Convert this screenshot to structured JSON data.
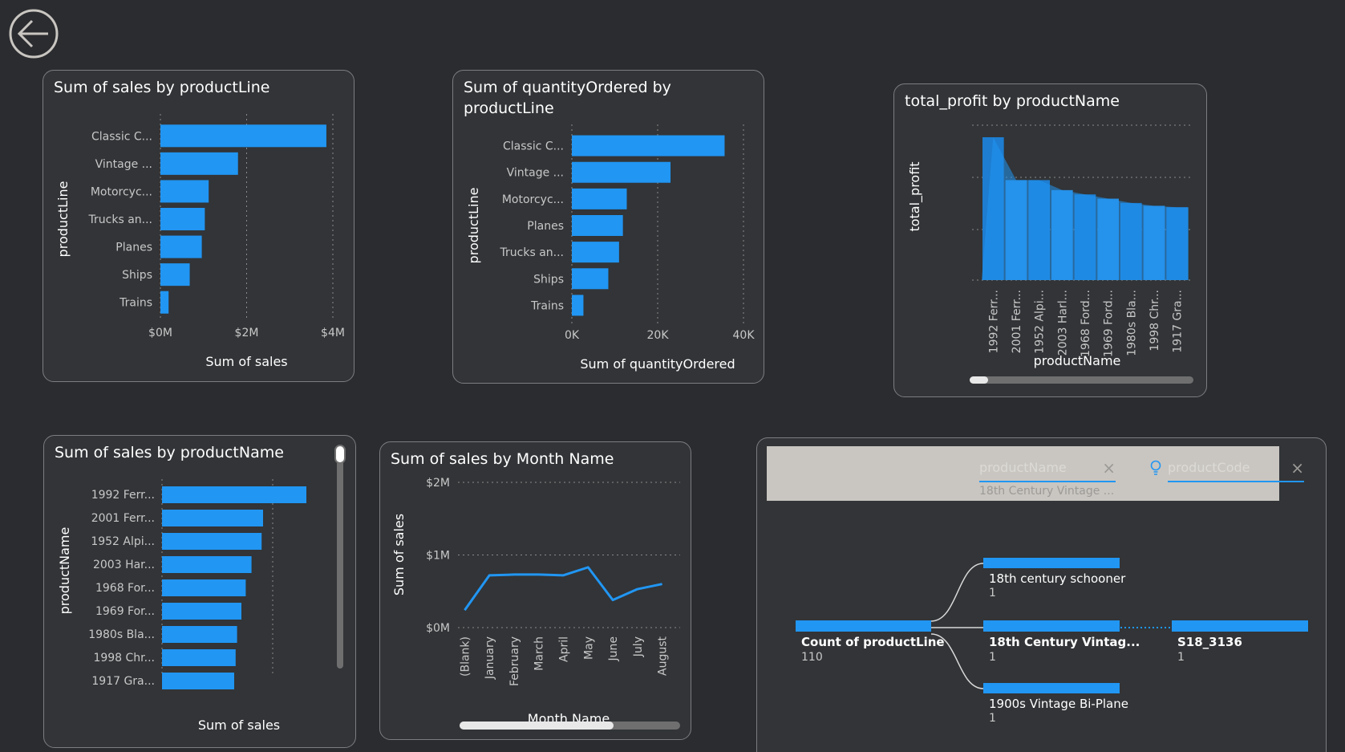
{
  "colors": {
    "background": "#2b2c30",
    "card": "#323437",
    "accent": "#2196f3",
    "text": "#ffffff"
  },
  "nav": {
    "back_icon": "back-arrow-icon"
  },
  "charts": {
    "c1": {
      "title": "Sum of sales by productLine"
    },
    "c2": {
      "title": "Sum of quantityOrdered by productLine"
    },
    "c3": {
      "title": "total_profit by productName"
    },
    "c4": {
      "title": "Sum of sales by productName"
    },
    "c5": {
      "title": "Sum of sales by Month Name"
    }
  },
  "chart_data": [
    {
      "id": "c1",
      "type": "bar",
      "orientation": "horizontal",
      "title": "Sum of sales by productLine",
      "categories": [
        "Classic C...",
        "Vintage ...",
        "Motorcyc...",
        "Trucks an...",
        "Planes",
        "Ships",
        "Trains"
      ],
      "values": [
        3.85,
        1.8,
        1.12,
        1.03,
        0.96,
        0.68,
        0.19
      ],
      "xlabel": "Sum of sales",
      "ylabel": "productLine",
      "xlim": [
        0,
        4
      ],
      "xticks": [
        0,
        2,
        4
      ],
      "xtick_labels": [
        "$0M",
        "$2M",
        "$4M"
      ]
    },
    {
      "id": "c2",
      "type": "bar",
      "orientation": "horizontal",
      "title": "Sum of quantityOrdered by productLine",
      "categories": [
        "Classic C...",
        "Vintage ...",
        "Motorcyc...",
        "Planes",
        "Trucks an...",
        "Ships",
        "Trains"
      ],
      "values": [
        35600,
        23000,
        12800,
        11900,
        11000,
        8500,
        2700
      ],
      "xlabel": "Sum of quantityOrdered",
      "ylabel": "productLine",
      "xlim": [
        0,
        40000
      ],
      "xticks": [
        0,
        20000,
        40000
      ],
      "xtick_labels": [
        "0K",
        "20K",
        "40K"
      ]
    },
    {
      "id": "c3",
      "type": "area",
      "title": "total_profit by productName",
      "categories": [
        "1992 Ferr...",
        "2001 Ferr...",
        "1952 Alpi...",
        "2003 Harl...",
        "1968 Ford...",
        "1969 Ford...",
        "1980s Bla...",
        "1998 Chr...",
        "1917 Gra..."
      ],
      "values": [
        100,
        70,
        70,
        63,
        60,
        57,
        54,
        52,
        51
      ],
      "xlabel": "productName",
      "ylabel": "total_profit"
    },
    {
      "id": "c4",
      "type": "bar",
      "orientation": "horizontal",
      "title": "Sum of sales by productName",
      "categories": [
        "1992 Ferr...",
        "2001 Ferr...",
        "1952 Alpi...",
        "2003 Har...",
        "1968 For...",
        "1969 For...",
        "1980s Bla...",
        "1998 Chr...",
        "1917 Gra..."
      ],
      "values": [
        100,
        70,
        69,
        62,
        58,
        55,
        52,
        51,
        50
      ],
      "xlabel": "Sum of sales",
      "ylabel": "productName"
    },
    {
      "id": "c5",
      "type": "line",
      "title": "Sum of sales by Month Name",
      "categories": [
        "(Blank)",
        "January",
        "February",
        "March",
        "April",
        "May",
        "June",
        "July",
        "August"
      ],
      "values": [
        0.24,
        0.72,
        0.73,
        0.73,
        0.72,
        0.83,
        0.38,
        0.53,
        0.6
      ],
      "xlabel": "Month Name",
      "ylabel": "Sum of sales",
      "ylim": [
        0,
        2
      ],
      "yticks": [
        0,
        1,
        2
      ],
      "ytick_labels": [
        "$0M",
        "$1M",
        "$2M"
      ]
    }
  ],
  "decomp": {
    "header": {
      "productName": "productName",
      "productName_value": "18th Century Vintage ...",
      "productCode": "productCode"
    },
    "root": {
      "label": "Count of productLine",
      "value": "110"
    },
    "level1": [
      {
        "label": "18th century schooner",
        "value": "1"
      },
      {
        "label": "18th Century Vintag...",
        "value": "1"
      },
      {
        "label": "1900s Vintage Bi-Plane",
        "value": "1"
      }
    ],
    "level2": {
      "label": "S18_3136",
      "value": "1"
    }
  }
}
